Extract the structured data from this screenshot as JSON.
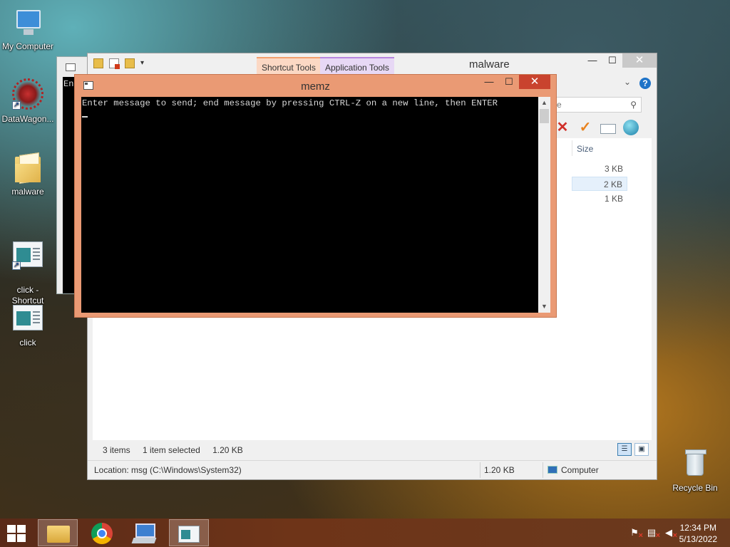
{
  "desktop": {
    "icons": [
      {
        "label": "My Computer",
        "icon": "computer-icon"
      },
      {
        "label": "DataWagon...",
        "icon": "virus-icon"
      },
      {
        "label": "malware",
        "icon": "folder-icon"
      },
      {
        "label": "click -\nShortcut",
        "icon": "app-shortcut-icon"
      },
      {
        "label": "click",
        "icon": "app-icon"
      },
      {
        "label": "Recycle Bin",
        "icon": "recycle-bin-icon"
      }
    ]
  },
  "back_console": {
    "text": "En"
  },
  "explorer": {
    "title": "malware",
    "context_tabs": [
      "Shortcut Tools",
      "Application Tools"
    ],
    "search_placeholder": "re",
    "column_size": "Size",
    "rows": [
      {
        "size": "3 KB",
        "selected": false
      },
      {
        "size": "2 KB",
        "selected": true
      },
      {
        "size": "1 KB",
        "selected": false
      }
    ],
    "status_items": "3 items",
    "status_selected": "1 item selected",
    "status_selected_size": "1.20 KB",
    "details_location": "Location: msg (C:\\Windows\\System32)",
    "details_size": "1.20 KB",
    "details_zone": "Computer",
    "caption": {
      "minimize": "—",
      "maximize": "☐",
      "close": "✕"
    },
    "help": "?"
  },
  "memz": {
    "title": "memz",
    "prompt": "Enter message to send; end message by pressing CTRL-Z on a new line, then ENTER",
    "caption": {
      "minimize": "—",
      "maximize": "☐",
      "close": "✕"
    }
  },
  "taskbar": {
    "apps": [
      "file-explorer",
      "chrome",
      "computer",
      "click"
    ],
    "clock_time": "12:34 PM",
    "clock_date": "5/13/2022"
  },
  "colors": {
    "accent_orange": "#ea9a74",
    "close_red": "#c9432e"
  }
}
